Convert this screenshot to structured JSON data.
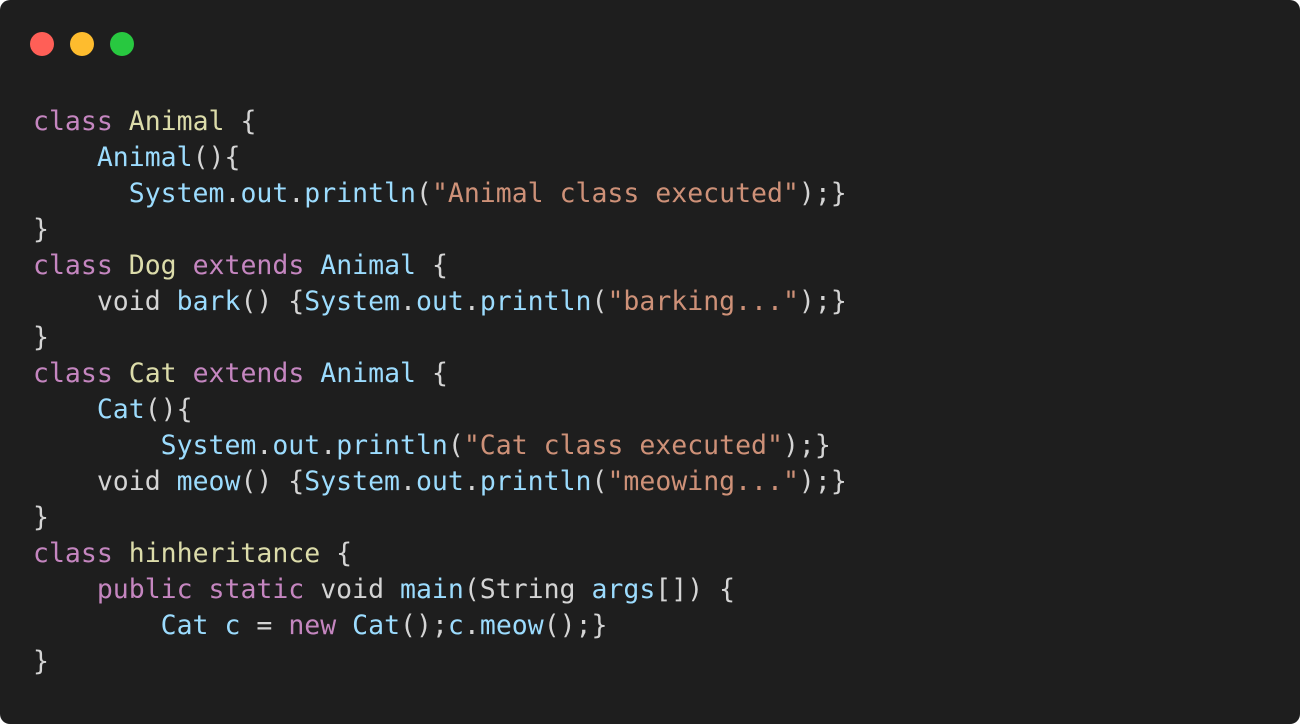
{
  "window": {
    "background": "#1e1e1e",
    "buttons": [
      {
        "name": "close-button",
        "color": "#ff5f57"
      },
      {
        "name": "minimize-button",
        "color": "#febc2e"
      },
      {
        "name": "maximize-button",
        "color": "#28c840"
      }
    ]
  },
  "theme": {
    "keyword": "#c586c0",
    "class": "#dcdcaa",
    "ident": "#9cdcfe",
    "string": "#ce9178",
    "plain": "#d4d4d4"
  },
  "code": {
    "language": "java",
    "lines": [
      [
        {
          "t": "keyword",
          "v": "class"
        },
        {
          "t": "space",
          "v": " "
        },
        {
          "t": "class",
          "v": "Animal"
        },
        {
          "t": "plain",
          "v": " {"
        }
      ],
      [
        {
          "t": "space",
          "v": "    "
        },
        {
          "t": "ident",
          "v": "Animal"
        },
        {
          "t": "plain",
          "v": "(){"
        }
      ],
      [
        {
          "t": "space",
          "v": "      "
        },
        {
          "t": "ident",
          "v": "System"
        },
        {
          "t": "plain",
          "v": "."
        },
        {
          "t": "ident",
          "v": "out"
        },
        {
          "t": "plain",
          "v": "."
        },
        {
          "t": "ident",
          "v": "println"
        },
        {
          "t": "plain",
          "v": "("
        },
        {
          "t": "string",
          "v": "\"Animal class executed\""
        },
        {
          "t": "plain",
          "v": ");}"
        }
      ],
      [
        {
          "t": "plain",
          "v": "}"
        }
      ],
      [
        {
          "t": "keyword",
          "v": "class"
        },
        {
          "t": "space",
          "v": " "
        },
        {
          "t": "class",
          "v": "Dog"
        },
        {
          "t": "space",
          "v": " "
        },
        {
          "t": "keyword",
          "v": "extends"
        },
        {
          "t": "space",
          "v": " "
        },
        {
          "t": "ident",
          "v": "Animal"
        },
        {
          "t": "plain",
          "v": " {"
        }
      ],
      [
        {
          "t": "space",
          "v": "    "
        },
        {
          "t": "plain",
          "v": "void "
        },
        {
          "t": "ident",
          "v": "bark"
        },
        {
          "t": "plain",
          "v": "() {"
        },
        {
          "t": "ident",
          "v": "System"
        },
        {
          "t": "plain",
          "v": "."
        },
        {
          "t": "ident",
          "v": "out"
        },
        {
          "t": "plain",
          "v": "."
        },
        {
          "t": "ident",
          "v": "println"
        },
        {
          "t": "plain",
          "v": "("
        },
        {
          "t": "string",
          "v": "\"barking...\""
        },
        {
          "t": "plain",
          "v": ");}"
        }
      ],
      [
        {
          "t": "plain",
          "v": "}"
        }
      ],
      [
        {
          "t": "keyword",
          "v": "class"
        },
        {
          "t": "space",
          "v": " "
        },
        {
          "t": "class",
          "v": "Cat"
        },
        {
          "t": "space",
          "v": " "
        },
        {
          "t": "keyword",
          "v": "extends"
        },
        {
          "t": "space",
          "v": " "
        },
        {
          "t": "ident",
          "v": "Animal"
        },
        {
          "t": "plain",
          "v": " {"
        }
      ],
      [
        {
          "t": "space",
          "v": "    "
        },
        {
          "t": "ident",
          "v": "Cat"
        },
        {
          "t": "plain",
          "v": "(){"
        }
      ],
      [
        {
          "t": "space",
          "v": "        "
        },
        {
          "t": "ident",
          "v": "System"
        },
        {
          "t": "plain",
          "v": "."
        },
        {
          "t": "ident",
          "v": "out"
        },
        {
          "t": "plain",
          "v": "."
        },
        {
          "t": "ident",
          "v": "println"
        },
        {
          "t": "plain",
          "v": "("
        },
        {
          "t": "string",
          "v": "\"Cat class executed\""
        },
        {
          "t": "plain",
          "v": ");}"
        }
      ],
      [
        {
          "t": "space",
          "v": "    "
        },
        {
          "t": "plain",
          "v": "void "
        },
        {
          "t": "ident",
          "v": "meow"
        },
        {
          "t": "plain",
          "v": "() {"
        },
        {
          "t": "ident",
          "v": "System"
        },
        {
          "t": "plain",
          "v": "."
        },
        {
          "t": "ident",
          "v": "out"
        },
        {
          "t": "plain",
          "v": "."
        },
        {
          "t": "ident",
          "v": "println"
        },
        {
          "t": "plain",
          "v": "("
        },
        {
          "t": "string",
          "v": "\"meowing...\""
        },
        {
          "t": "plain",
          "v": ");}"
        }
      ],
      [
        {
          "t": "plain",
          "v": "}"
        }
      ],
      [
        {
          "t": "keyword",
          "v": "class"
        },
        {
          "t": "space",
          "v": " "
        },
        {
          "t": "class",
          "v": "hinheritance"
        },
        {
          "t": "plain",
          "v": " {"
        }
      ],
      [
        {
          "t": "space",
          "v": "    "
        },
        {
          "t": "keyword",
          "v": "public"
        },
        {
          "t": "space",
          "v": " "
        },
        {
          "t": "keyword",
          "v": "static"
        },
        {
          "t": "plain",
          "v": " void "
        },
        {
          "t": "ident",
          "v": "main"
        },
        {
          "t": "plain",
          "v": "(String "
        },
        {
          "t": "ident",
          "v": "args"
        },
        {
          "t": "plain",
          "v": "[]) {"
        }
      ],
      [
        {
          "t": "space",
          "v": "        "
        },
        {
          "t": "ident",
          "v": "Cat"
        },
        {
          "t": "space",
          "v": " "
        },
        {
          "t": "ident",
          "v": "c"
        },
        {
          "t": "plain",
          "v": " = "
        },
        {
          "t": "keyword",
          "v": "new"
        },
        {
          "t": "space",
          "v": " "
        },
        {
          "t": "ident",
          "v": "Cat"
        },
        {
          "t": "plain",
          "v": "();"
        },
        {
          "t": "ident",
          "v": "c"
        },
        {
          "t": "plain",
          "v": "."
        },
        {
          "t": "ident",
          "v": "meow"
        },
        {
          "t": "plain",
          "v": "();}"
        }
      ],
      [
        {
          "t": "plain",
          "v": "}"
        }
      ]
    ]
  }
}
